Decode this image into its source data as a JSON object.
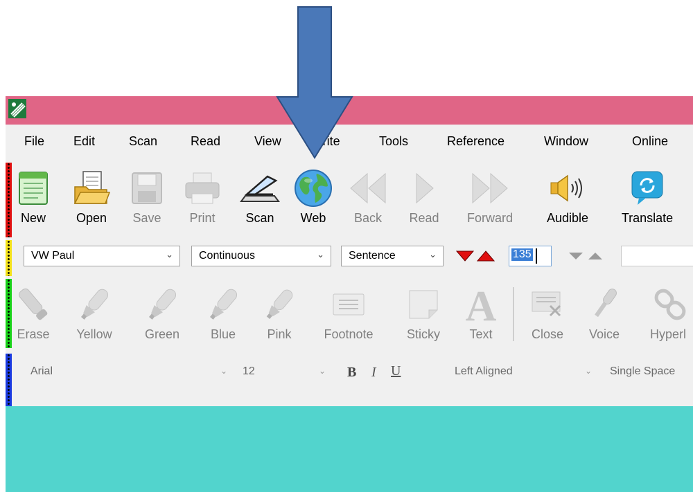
{
  "menu": [
    "File",
    "Edit",
    "Scan",
    "Read",
    "View",
    "Write",
    "Tools",
    "Reference",
    "Window",
    "Online"
  ],
  "toolbar_main": [
    {
      "label": "New",
      "icon": "new-document-icon",
      "enabled": true
    },
    {
      "label": "Open",
      "icon": "open-folder-icon",
      "enabled": true
    },
    {
      "label": "Save",
      "icon": "floppy-disk-icon",
      "enabled": false
    },
    {
      "label": "Print",
      "icon": "printer-icon",
      "enabled": false
    },
    {
      "label": "Scan",
      "icon": "scanner-icon",
      "enabled": true
    },
    {
      "label": "Web",
      "icon": "globe-icon",
      "enabled": true
    },
    {
      "label": "Back",
      "icon": "double-back-icon",
      "enabled": false
    },
    {
      "label": "Read",
      "icon": "play-icon",
      "enabled": false
    },
    {
      "label": "Forward",
      "icon": "double-forward-icon",
      "enabled": false
    },
    {
      "label": "Audible",
      "icon": "speaker-icon",
      "enabled": true
    },
    {
      "label": "Translate",
      "icon": "translate-icon",
      "enabled": true
    }
  ],
  "reading_bar": {
    "voice": "VW Paul",
    "mode": "Continuous",
    "unit": "Sentence",
    "speed": "135"
  },
  "study_tools": [
    {
      "label": "Erase",
      "icon": "eraser-icon"
    },
    {
      "label": "Yellow",
      "icon": "yellow-highlighter-icon"
    },
    {
      "label": "Green",
      "icon": "green-highlighter-icon"
    },
    {
      "label": "Blue",
      "icon": "blue-highlighter-icon"
    },
    {
      "label": "Pink",
      "icon": "pink-highlighter-icon"
    },
    {
      "label": "Footnote",
      "icon": "footnote-icon"
    },
    {
      "label": "Sticky",
      "icon": "sticky-note-icon"
    },
    {
      "label": "Text",
      "icon": "text-icon"
    },
    {
      "label": "Close",
      "icon": "close-note-icon"
    },
    {
      "label": "Voice",
      "icon": "microphone-icon"
    },
    {
      "label": "Hyperl",
      "icon": "hyperlink-icon"
    }
  ],
  "format_bar": {
    "font": "Arial",
    "size": "12",
    "bold": "B",
    "italic": "I",
    "underline": "U",
    "alignment": "Left Aligned",
    "spacing": "Single Space"
  },
  "colors": {
    "titlebar": "#e06586",
    "content": "#52d4cd",
    "annotation_arrow": "#4a78b8"
  }
}
